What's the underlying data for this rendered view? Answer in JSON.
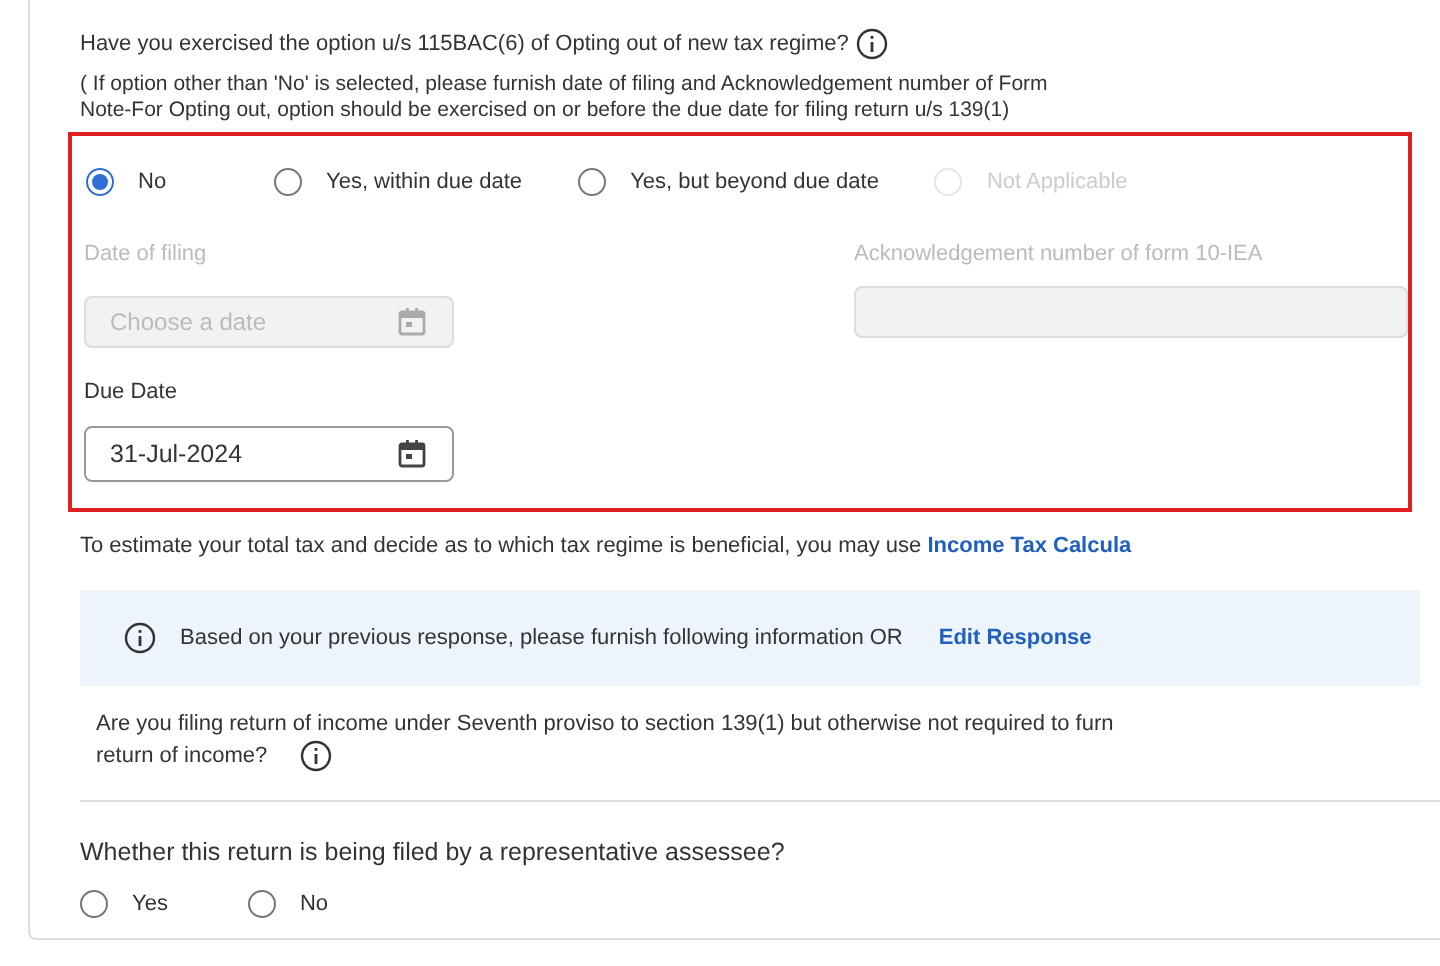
{
  "question": "Have you exercised the option u/s 115BAC(6) of Opting out of new tax regime?",
  "note_lines": [
    "( If option other than 'No' is selected, please furnish date of filing and Acknowledgement  number of Form",
    "Note-For Opting out, option should be exercised on or before the due date for filing return u/s 139(1)"
  ],
  "options": [
    {
      "label": "No",
      "selected": true,
      "disabled": false
    },
    {
      "label": "Yes, within due date",
      "selected": false,
      "disabled": false
    },
    {
      "label": "Yes, but beyond due date",
      "selected": false,
      "disabled": false
    },
    {
      "label": "Not Applicable",
      "selected": false,
      "disabled": true
    }
  ],
  "date_of_filing": {
    "label": "Date of filing",
    "placeholder": "Choose a date",
    "disabled": true
  },
  "acknowledgement": {
    "label": "Acknowledgement number of form 10-IEA",
    "disabled": true
  },
  "due_date": {
    "label": "Due Date",
    "value": "31-Jul-2024"
  },
  "estimate_text": "To estimate your total tax and decide as to which tax regime is beneficial, you may use",
  "calculator_link": "Income Tax Calcula",
  "info_banner": {
    "text": "Based on your previous response, please furnish following information OR",
    "link": "Edit Response"
  },
  "seventh_proviso": {
    "line1": "Are you filing return of income under Seventh proviso to section 139(1) but otherwise not required to furn",
    "line2": "return of income?"
  },
  "representative": {
    "question": "Whether this return is being filed by a representative assessee?",
    "options": [
      {
        "label": "Yes",
        "selected": false
      },
      {
        "label": "No",
        "selected": false
      }
    ]
  }
}
